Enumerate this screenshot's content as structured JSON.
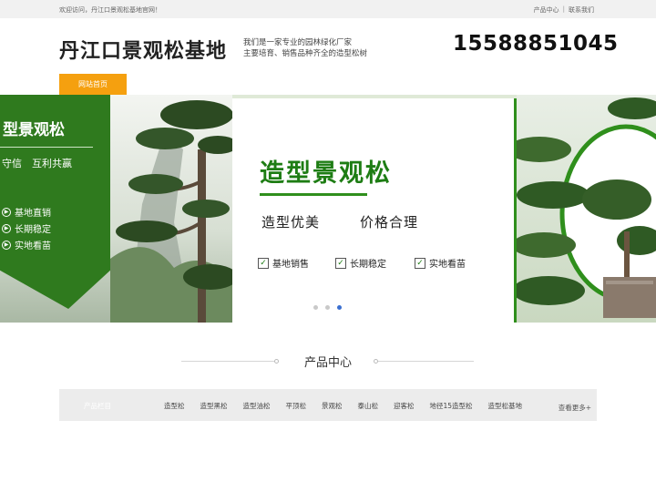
{
  "topbar": {
    "welcome": "欢迎访问，丹江口景观松基地官网！",
    "links": [
      "产品中心",
      "联系我们"
    ],
    "separator": "|"
  },
  "header": {
    "site_title": "丹江口景观松基地",
    "tagline_line1": "我们是一家专业的园林绿化厂家",
    "tagline_line2": "主要培育、销售品种齐全的造型松树",
    "phone": "15588851045"
  },
  "nav": {
    "home": "网站首页",
    "home_color": "#f5a00f"
  },
  "banner": {
    "panel_title": "型景观松",
    "panel_slogan": "守信　互利共赢",
    "panel_features": [
      "基地直销",
      "长期稳定",
      "实地看苗"
    ],
    "card_title": "造型景观松",
    "card_sub1": "造型优美",
    "card_sub2": "价格合理",
    "card_checks": [
      "基地销售",
      "长期稳定",
      "实地看苗"
    ],
    "slide_count": 3,
    "active_slide": 3,
    "accent_green": "#2f7a1e"
  },
  "products": {
    "section_title": "产品中心",
    "category_label": "产品栏目",
    "categories": [
      "造型松",
      "造型黑松",
      "造型油松",
      "平顶松",
      "景观松",
      "泰山松",
      "迎客松",
      "地径15造型松",
      "造型松基地"
    ],
    "more": "查看更多+"
  }
}
